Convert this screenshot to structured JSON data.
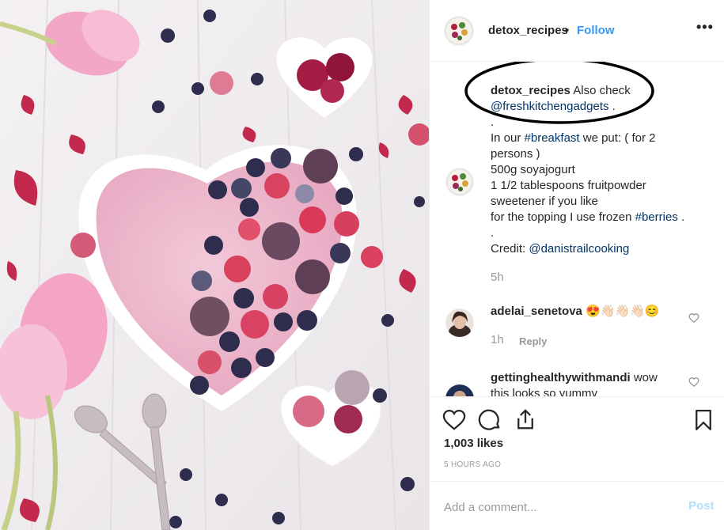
{
  "post": {
    "username": "detox_recipes",
    "separator": "•",
    "follow_label": "Follow",
    "more_label": "•••"
  },
  "caption": {
    "username": "detox_recipes",
    "lines": [
      {
        "parts": [
          {
            "t": "Also check",
            "k": "text"
          }
        ]
      },
      {
        "parts": [
          {
            "t": "@freshkitchengadgets",
            "k": "link"
          },
          {
            "t": " .",
            "k": "text"
          }
        ]
      },
      {
        "parts": [
          {
            "t": ".",
            "k": "text"
          }
        ]
      },
      {
        "parts": [
          {
            "t": "In our ",
            "k": "text"
          },
          {
            "t": "#breakfast",
            "k": "link"
          },
          {
            "t": " we put: ( for 2",
            "k": "text"
          }
        ]
      },
      {
        "parts": [
          {
            "t": "persons )",
            "k": "text"
          }
        ]
      },
      {
        "parts": [
          {
            "t": "500g soyajogurt",
            "k": "text"
          }
        ]
      },
      {
        "parts": [
          {
            "t": "1 1/2 tablespoons fruitpowder",
            "k": "text"
          }
        ]
      },
      {
        "parts": [
          {
            "t": "sweetener if you like",
            "k": "text"
          }
        ]
      },
      {
        "parts": [
          {
            "t": "for the topping I use frozen ",
            "k": "text"
          },
          {
            "t": "#berries",
            "k": "link"
          },
          {
            "t": " .",
            "k": "text"
          }
        ]
      },
      {
        "parts": [
          {
            "t": ".",
            "k": "text"
          }
        ]
      },
      {
        "parts": [
          {
            "t": "Credit: ",
            "k": "text"
          },
          {
            "t": "@danistrailcooking",
            "k": "link"
          }
        ]
      }
    ],
    "time": "5h"
  },
  "comments": [
    {
      "username": "adelai_senetova",
      "text": "😍👋🏻👋🏻👋🏻😊",
      "time": "1h",
      "reply_label": "Reply"
    },
    {
      "username": "gettinghealthywithmandi",
      "text": "wow",
      "text2": "this looks so yummy"
    }
  ],
  "actions": {
    "likes": "1,003 likes",
    "ago": "5 HOURS AGO",
    "icons": [
      "heart-icon",
      "comment-icon",
      "share-icon",
      "bookmark-icon"
    ]
  },
  "composer": {
    "placeholder": "Add a comment...",
    "post_label": "Post"
  },
  "colors": {
    "follow": "#3897f0",
    "link": "#003569",
    "muted": "#999999",
    "post_disabled": "#b2dffc"
  }
}
